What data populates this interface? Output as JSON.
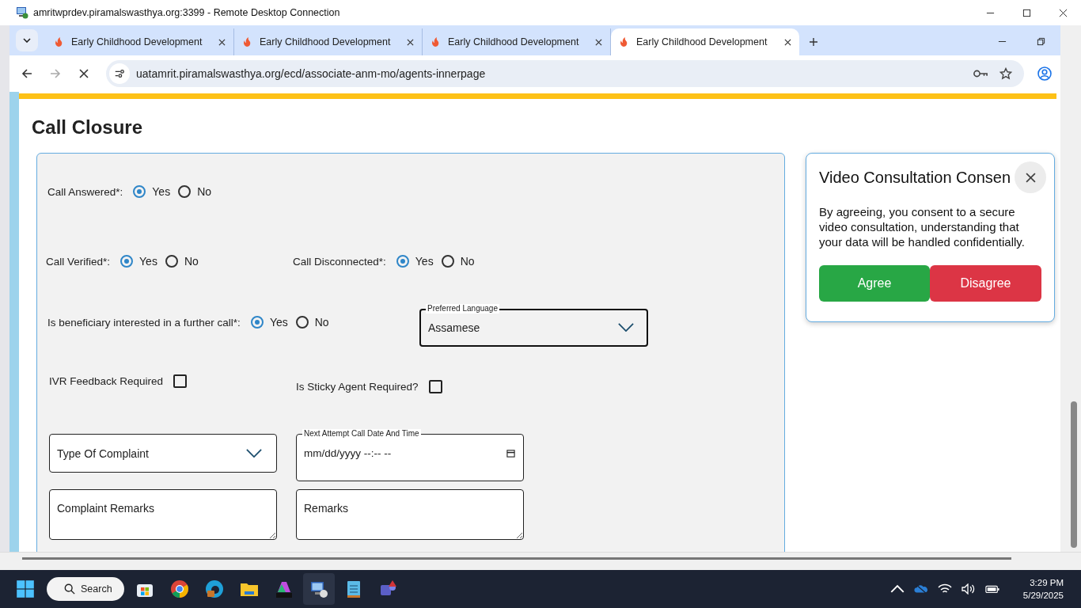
{
  "rdp_window": {
    "title": "amritwprdev.piramalswasthya.org:3399 - Remote Desktop Connection"
  },
  "browser": {
    "tabs": [
      {
        "title": "Early Childhood Development",
        "selected": false
      },
      {
        "title": "Early Childhood Development",
        "selected": false
      },
      {
        "title": "Early Childhood Development",
        "selected": false
      },
      {
        "title": "Early Childhood Development",
        "selected": true
      }
    ],
    "address": "uatamrit.piramalswasthya.org/ecd/associate-anm-mo/agents-innerpage"
  },
  "page": {
    "heading": "Call Closure",
    "form": {
      "radio_groups": [
        {
          "label": "Call Answered*:",
          "options": [
            {
              "label": "Yes",
              "selected": true
            },
            {
              "label": "No",
              "selected": false
            }
          ]
        },
        {
          "label": "Call Verified*:",
          "options": [
            {
              "label": "Yes",
              "selected": true
            },
            {
              "label": "No",
              "selected": false
            }
          ]
        },
        {
          "label": "Call Disconnected*:",
          "options": [
            {
              "label": "Yes",
              "selected": true
            },
            {
              "label": "No",
              "selected": false
            }
          ]
        },
        {
          "label": "Is beneficiary interested in a further call*:",
          "options": [
            {
              "label": "Yes",
              "selected": true
            },
            {
              "label": "No",
              "selected": false
            }
          ]
        }
      ],
      "preferred_language": {
        "label": "Preferred Language",
        "value": "Assamese"
      },
      "checkboxes": [
        {
          "label": "IVR Feedback Required",
          "checked": false
        },
        {
          "label": "Is Sticky Agent Required?",
          "checked": false
        }
      ],
      "complaint_type": {
        "placeholder": "Type Of Complaint"
      },
      "next_attempt": {
        "label": "Next Attempt Call Date And Time",
        "placeholder": "mm/dd/yyyy --:-- --"
      },
      "complaint_remarks": {
        "placeholder": "Complaint Remarks"
      },
      "remarks": {
        "placeholder": "Remarks"
      }
    }
  },
  "consent": {
    "title": "Video Consultation Consen",
    "message": "By agreeing, you consent to a secure video consultation, understanding that your data will be handled confidentially.",
    "buttons": [
      {
        "label": "Agree",
        "kind": "agree"
      },
      {
        "label": "Disagree",
        "kind": "disagree"
      }
    ]
  },
  "taskbar": {
    "search": "Search",
    "time": "3:29 PM",
    "date": "5/29/2025"
  }
}
